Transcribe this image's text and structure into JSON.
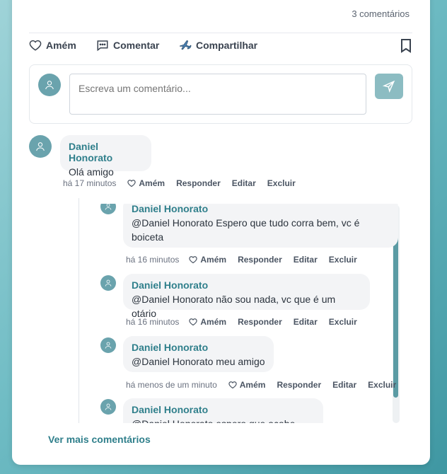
{
  "post": {
    "comment_count": "3 comentários",
    "actions": {
      "amen": "Amém",
      "comment": "Comentar",
      "share": "Compartilhar"
    }
  },
  "composer": {
    "placeholder": "Escreva um comentário..."
  },
  "comments": [
    {
      "author": "Daniel Honorato",
      "text": "Olá amigo",
      "time": "há 17 minutos",
      "amen": "Amém",
      "reply": "Responder",
      "edit": "Editar",
      "delete": "Excluir"
    }
  ],
  "replies": [
    {
      "author": "Daniel Honorato",
      "text": "@Daniel Honorato Espero que tudo corra bem, vc é boiceta",
      "time": "há 16 minutos",
      "amen": "Amém",
      "reply": "Responder",
      "edit": "Editar",
      "delete": "Excluir"
    },
    {
      "author": "Daniel Honorato",
      "text": "@Daniel Honorato não sou nada, vc que é um otário",
      "time": "há 16 minutos",
      "amen": "Amém",
      "reply": "Responder",
      "edit": "Editar",
      "delete": "Excluir"
    },
    {
      "author": "Daniel Honorato",
      "text": "@Daniel Honorato meu amigo",
      "time": "há menos de um minuto",
      "amen": "Amém",
      "reply": "Responder",
      "edit": "Editar",
      "delete": "Excluir"
    },
    {
      "author": "Daniel Honorato",
      "text": "@Daniel Honorato espero que acabe logo"
    }
  ],
  "load_more": "Ver mais comentários",
  "colors": {
    "accent": "#2f7f8b",
    "avatar": "#6aa3ad",
    "send_button": "#8cbcc2"
  }
}
